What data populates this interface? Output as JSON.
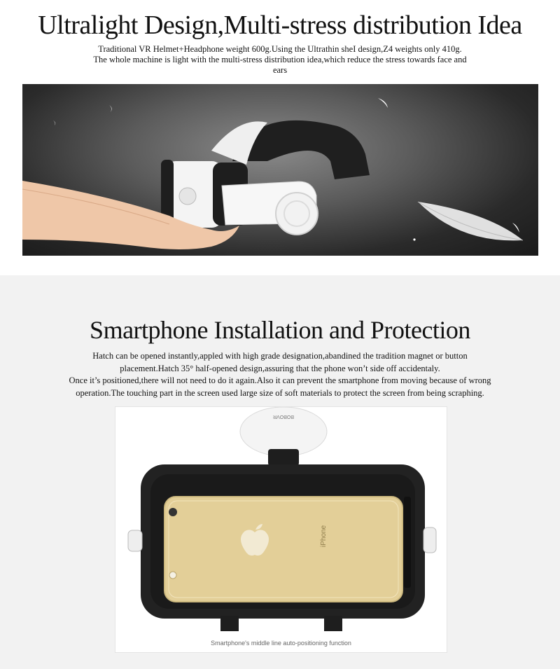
{
  "section1": {
    "title": "Ultralight Design,Multi-stress distribution Idea",
    "description_lines": [
      "Traditional VR Helmet+Headphone weight 600g.Using the Ultrathin sheI design,Z4 weights only 410g.",
      "The whole machine is light with the multi-stress distribution idea,which reduce the stress towards face and",
      "ears"
    ]
  },
  "section2": {
    "title": "Smartphone Installation and Protection",
    "description_lines": [
      "Hatch can be opened instantly,appled with high grade designation,abandined the tradition magnet or button",
      "placement.Hatch 35° half-opened design,assuring that the phone won’t side off accidentaly.",
      "Once it’s positioned,there will not need to do it again.Also it can prevent the smartphone from moving because of wrong",
      "operation.The touching part in the screen used large size of soft materials to protect the screen from being scraphing."
    ],
    "caption": "Smartphone's middle line auto-positioning function",
    "brand_text": "BOBOVR",
    "phone_text": "iPhone"
  },
  "colors": {
    "photo_dark": "#2a2a2a",
    "headset_white": "#f4f4f4",
    "headset_black": "#1e1e1e",
    "phone_gold": "#e3cf98"
  }
}
